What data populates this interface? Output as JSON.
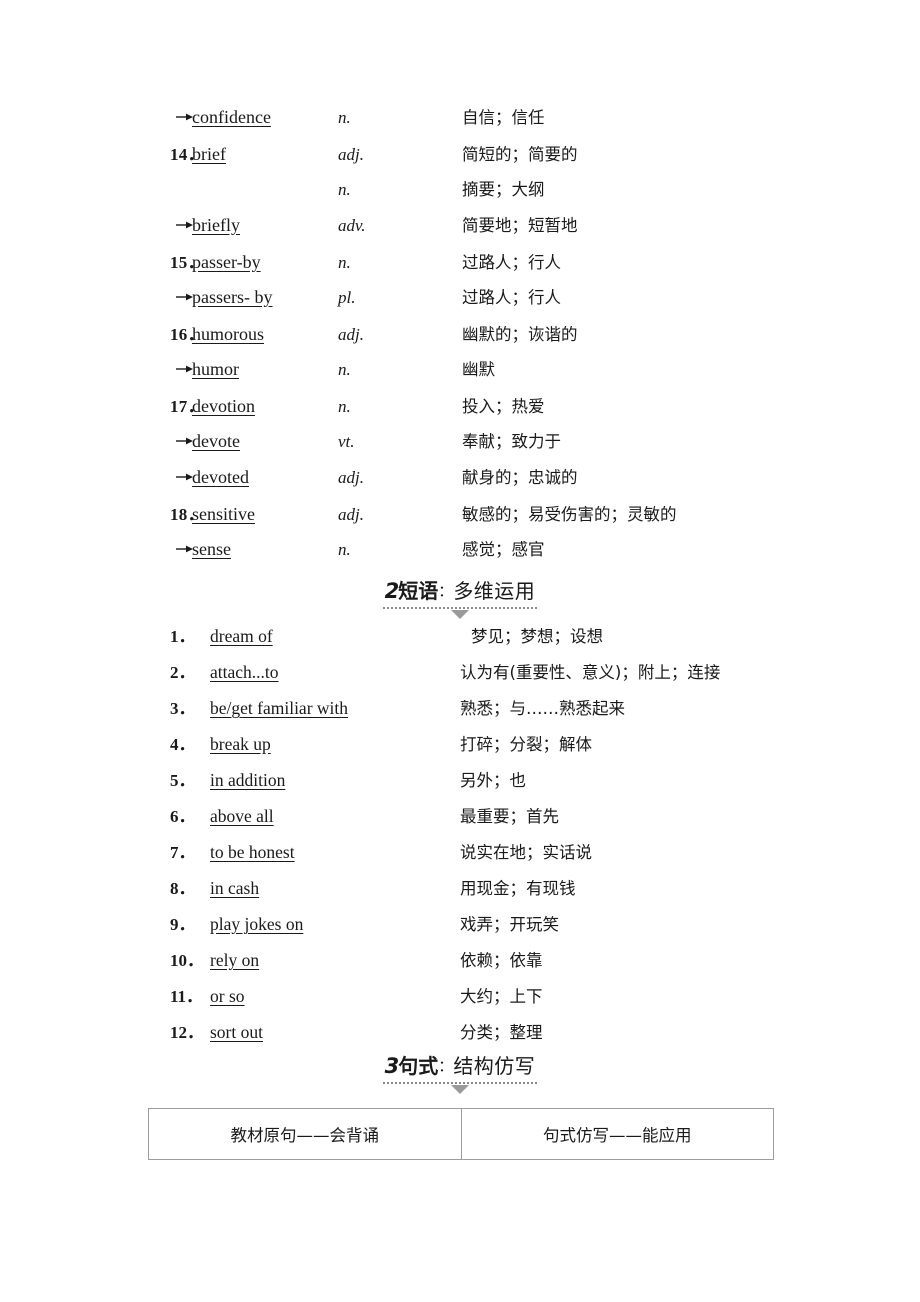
{
  "vocabulary": {
    "rows": [
      {
        "index": "",
        "arrow": true,
        "word": "confidence",
        "pos": "n.",
        "meaning": "自信；信任"
      },
      {
        "index": "14．",
        "arrow": false,
        "word": "brief",
        "pos": "adj.",
        "meaning": "简短的；简要的"
      },
      {
        "index": "",
        "arrow": false,
        "word": "",
        "pos": "n.",
        "meaning": "摘要；大纲"
      },
      {
        "index": "",
        "arrow": true,
        "word": "briefly",
        "pos": "adv.",
        "meaning": "简要地；短暂地"
      },
      {
        "index": "15．",
        "arrow": false,
        "word": "passer-by",
        "pos": "n.",
        "meaning": "过路人；行人"
      },
      {
        "index": "",
        "arrow": true,
        "word": "passers- by",
        "pos": "pl.",
        "meaning": "过路人；行人"
      },
      {
        "index": "16．",
        "arrow": false,
        "word": "humorous",
        "pos": "adj.",
        "meaning": "幽默的；诙谐的"
      },
      {
        "index": "",
        "arrow": true,
        "word": "humor",
        "pos": "n.",
        "meaning": "幽默"
      },
      {
        "index": "17．",
        "arrow": false,
        "word": "devotion",
        "pos": "n.",
        "meaning": "投入；热爱"
      },
      {
        "index": "",
        "arrow": true,
        "word": "devote",
        "pos": "vt.",
        "meaning": "奉献；致力于"
      },
      {
        "index": "",
        "arrow": true,
        "word": "devoted",
        "pos": "adj.",
        "meaning": "献身的；忠诚的"
      },
      {
        "index": "18．",
        "arrow": false,
        "word": "sensitive",
        "pos": "adj.",
        "meaning": "敏感的；易受伤害的；灵敏的"
      },
      {
        "index": "",
        "arrow": true,
        "word": "sense",
        "pos": "n.",
        "meaning": "感觉；感官"
      }
    ]
  },
  "banner_phrases": {
    "number": "2",
    "main": "短语",
    "separator": "：",
    "sub": "多维运用"
  },
  "phrases": {
    "rows": [
      {
        "index": "1．",
        "phrase": "dream of",
        "meaning": "梦见；梦想；设想",
        "indent": true
      },
      {
        "index": "2．",
        "phrase": "attach...to",
        "meaning": "认为有(重要性、意义)；附上；连接",
        "indent": false
      },
      {
        "index": "3．",
        "phrase": "be/get familiar with",
        "meaning": "熟悉；与……熟悉起来",
        "indent": false
      },
      {
        "index": "4．",
        "phrase": "break up",
        "meaning": "打碎；分裂；解体",
        "indent": false
      },
      {
        "index": "5．",
        "phrase": "in addition",
        "meaning": "另外；也",
        "indent": false
      },
      {
        "index": "6．",
        "phrase": "above all",
        "meaning": "最重要；首先",
        "indent": false
      },
      {
        "index": "7．",
        "phrase": "to be honest",
        "meaning": "说实在地；实话说",
        "indent": false
      },
      {
        "index": "8．",
        "phrase": "in cash",
        "meaning": "用现金；有现钱",
        "indent": false
      },
      {
        "index": "9．",
        "phrase": "play jokes on",
        "meaning": "戏弄；开玩笑",
        "indent": false
      },
      {
        "index": "10．",
        "phrase": "rely on",
        "meaning": "依赖；依靠",
        "indent": false
      },
      {
        "index": "11．",
        "phrase": "or so",
        "meaning": "大约；上下",
        "indent": false
      },
      {
        "index": "12．",
        "phrase": "sort out",
        "meaning": "分类；整理",
        "indent": false
      }
    ]
  },
  "banner_sentences": {
    "number": "3",
    "main": "句式",
    "separator": "：",
    "sub": "结构仿写"
  },
  "sentence_table": {
    "headers": [
      "教材原句——会背诵",
      "句式仿写——能应用"
    ]
  }
}
